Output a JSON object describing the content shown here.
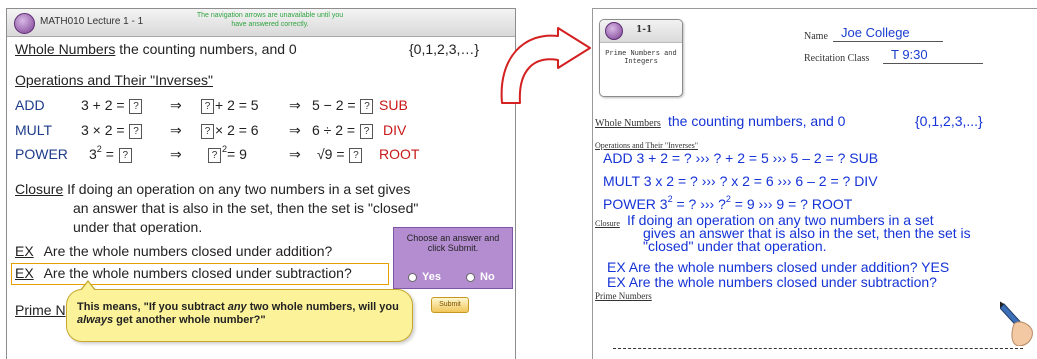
{
  "left": {
    "window_title": "MATH010 Lecture 1 - 1",
    "nav_note": "The navigation arrows are unavailable until you have answered correctly.",
    "whole_numbers": {
      "label": "Whole Numbers",
      "text": "the counting numbers, and 0",
      "set": "{0,1,2,3,…}"
    },
    "operations_heading": "Operations and Their \"Inverses\"",
    "rows": [
      {
        "op": "ADD",
        "c1": "3 + 2 =",
        "c2b": "+ 2 = 5",
        "c3a": "5 − 2 =",
        "inv": "SUB"
      },
      {
        "op": "MULT",
        "c1": "3 × 2 =",
        "c2b": "× 2 = 6",
        "c3a": "6 ÷ 2 =",
        "inv": "DIV"
      },
      {
        "op": "POWER",
        "c1": "3",
        "c1sup": "2",
        "c1b": "=",
        "c2b": "= 9",
        "c2sup": "2",
        "c3a": "√9 =",
        "inv": "ROOT"
      }
    ],
    "box_symbol": "?",
    "arrow": "⇒",
    "closure": {
      "label": "Closure",
      "line1": "If doing an operation on any two numbers in a set gives",
      "line2": "an answer that is also in the set, then the set is \"closed\"",
      "line3": "under that operation."
    },
    "ex1": {
      "label": "EX",
      "text": "Are the whole numbers closed under addition?"
    },
    "ex2": {
      "label": "EX",
      "text": "Are the whole numbers closed under subtraction?"
    },
    "prime_partial": "Prime N",
    "chooser": {
      "text": "Choose an answer and click Submit.",
      "yes": "Yes",
      "no": "No"
    },
    "callout": {
      "pre": "This means, \"If you subtract ",
      "em1": "any",
      "mid": " two whole numbers, will you ",
      "em2": "always",
      "post": " get another whole number?\""
    },
    "submit": "Submit"
  },
  "right": {
    "lecture_num": "1-1",
    "lecture_title": "Prime Numbers and Integers",
    "name_label": "Name",
    "name_value": "Joe College",
    "class_label": "Recitation Class",
    "class_value": "T 9:30",
    "whole_numbers_label": "Whole Numbers",
    "whole_numbers_text": "the counting numbers, and 0",
    "whole_numbers_set": "{0,1,2,3,...}",
    "operations_heading": "Operations and Their \"Inverses\"",
    "add_line": "ADD  3 + 2 = ?   ›››   ? + 2 = 5   ›››   5 – 2 = ?    SUB",
    "mult_line": "MULT  3 x 2 = ?  ›››   ? x 2 = 6   ›››   6 – 2 = ?    DIV",
    "power_a": "POWER  3",
    "power_sup": "2",
    "power_b": " = ?   ›››     ?",
    "power_sup2": "2",
    "power_c": " = 9      ›››     9  = ?   ROOT",
    "closure_label": "Closure",
    "closure_1": "If doing an operation on any two numbers in a set",
    "closure_2": "gives an answer that is also in the set, then the set is",
    "closure_3": "\"closed\" under that operation.",
    "ex1": "EX Are the whole numbers closed under addition?  YES",
    "ex2": "EX Are the whole numbers closed under subtraction?",
    "prime_numbers_label": "Prime Numbers"
  },
  "colors": {
    "accent_red": "#c81818",
    "ink_blue": "#1533d6",
    "chooser_purple": "#b48dd1",
    "callout_yellow": "#fbf29a"
  },
  "icons": [
    "logo-icon",
    "curved-arrow-icon",
    "radio-icon",
    "pen-icon"
  ]
}
